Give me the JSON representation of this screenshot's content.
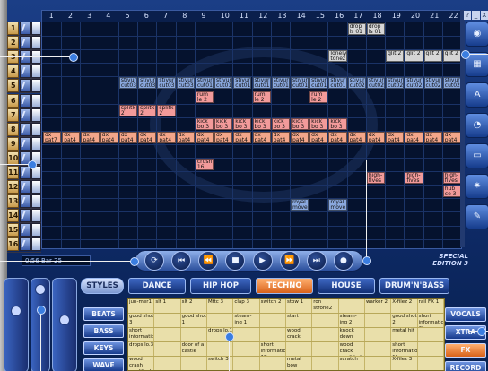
{
  "ruler": [
    "1",
    "2",
    "3",
    "4",
    "5",
    "6",
    "7",
    "8",
    "9",
    "10",
    "11",
    "12",
    "13",
    "14",
    "15",
    "16",
    "17",
    "18",
    "19",
    "20",
    "21",
    "22"
  ],
  "tracks": [
    "1",
    "2",
    "3",
    "4",
    "5",
    "6",
    "7",
    "8",
    "9",
    "10",
    "11",
    "12",
    "13",
    "14",
    "15",
    "16"
  ],
  "blocks": [
    {
      "row": 0,
      "col": 16,
      "span": 1,
      "text": "drop is 01",
      "color": "gray"
    },
    {
      "row": 0,
      "col": 17,
      "span": 1,
      "text": "drop is 01",
      "color": "gray"
    },
    {
      "row": 2,
      "col": 15,
      "span": 1,
      "text": "lonely tonez 3",
      "color": "gray"
    },
    {
      "row": 2,
      "col": 18,
      "span": 1,
      "text": "glit 2",
      "color": "gray"
    },
    {
      "row": 2,
      "col": 19,
      "span": 1,
      "text": "glit 2",
      "color": "gray"
    },
    {
      "row": 2,
      "col": 20,
      "span": 1,
      "text": "glit 2",
      "color": "gray"
    },
    {
      "row": 2,
      "col": 21,
      "span": 1,
      "text": "glit 2",
      "color": "gray"
    },
    {
      "row": 4,
      "col": 4,
      "span": 1,
      "text": "stivur cut03",
      "color": "blue"
    },
    {
      "row": 4,
      "col": 5,
      "span": 1,
      "text": "stivur cut03",
      "color": "blue"
    },
    {
      "row": 4,
      "col": 6,
      "span": 1,
      "text": "stivur cut03",
      "color": "blue"
    },
    {
      "row": 4,
      "col": 7,
      "span": 1,
      "text": "stivur cut03",
      "color": "blue"
    },
    {
      "row": 4,
      "col": 8,
      "span": 1,
      "text": "stivur cut01",
      "color": "blue"
    },
    {
      "row": 4,
      "col": 9,
      "span": 1,
      "text": "stivur cut01",
      "color": "blue"
    },
    {
      "row": 4,
      "col": 10,
      "span": 1,
      "text": "stivur cut01",
      "color": "blue"
    },
    {
      "row": 4,
      "col": 11,
      "span": 1,
      "text": "stivur cut01",
      "color": "blue"
    },
    {
      "row": 4,
      "col": 12,
      "span": 1,
      "text": "stivur cut01",
      "color": "blue"
    },
    {
      "row": 4,
      "col": 13,
      "span": 1,
      "text": "stivur cut01",
      "color": "blue"
    },
    {
      "row": 4,
      "col": 14,
      "span": 1,
      "text": "stivur cut01",
      "color": "blue"
    },
    {
      "row": 4,
      "col": 15,
      "span": 1,
      "text": "stivur cut01",
      "color": "blue"
    },
    {
      "row": 4,
      "col": 16,
      "span": 1,
      "text": "stivur cut02",
      "color": "blue"
    },
    {
      "row": 4,
      "col": 17,
      "span": 1,
      "text": "stivur cut02",
      "color": "blue"
    },
    {
      "row": 4,
      "col": 18,
      "span": 1,
      "text": "stivur cut02",
      "color": "blue"
    },
    {
      "row": 4,
      "col": 19,
      "span": 1,
      "text": "stivur cut02",
      "color": "blue"
    },
    {
      "row": 4,
      "col": 20,
      "span": 1,
      "text": "stivur cut02",
      "color": "blue"
    },
    {
      "row": 4,
      "col": 21,
      "span": 1,
      "text": "stivur cut02",
      "color": "blue"
    },
    {
      "row": 5,
      "col": 8,
      "span": 1,
      "text": "rum le 2",
      "color": "pink"
    },
    {
      "row": 5,
      "col": 11,
      "span": 1,
      "text": "rum le 2",
      "color": "pink"
    },
    {
      "row": 5,
      "col": 14,
      "span": 1,
      "text": "rum le 2",
      "color": "pink"
    },
    {
      "row": 6,
      "col": 4,
      "span": 1,
      "text": "splitk 2",
      "color": "pink"
    },
    {
      "row": 6,
      "col": 5,
      "span": 1,
      "text": "splitk 2",
      "color": "pink"
    },
    {
      "row": 6,
      "col": 6,
      "span": 1,
      "text": "splitk 2",
      "color": "pink"
    },
    {
      "row": 7,
      "col": 8,
      "span": 1,
      "text": "kick bo 3",
      "color": "pink"
    },
    {
      "row": 7,
      "col": 9,
      "span": 1,
      "text": "kick bo 3",
      "color": "pink"
    },
    {
      "row": 7,
      "col": 10,
      "span": 1,
      "text": "kick bo 3",
      "color": "pink"
    },
    {
      "row": 7,
      "col": 11,
      "span": 1,
      "text": "kick bo 3",
      "color": "pink"
    },
    {
      "row": 7,
      "col": 12,
      "span": 1,
      "text": "kick bo 3",
      "color": "pink"
    },
    {
      "row": 7,
      "col": 13,
      "span": 1,
      "text": "kick bo 3",
      "color": "pink"
    },
    {
      "row": 7,
      "col": 14,
      "span": 1,
      "text": "kick bo 3",
      "color": "pink"
    },
    {
      "row": 7,
      "col": 15,
      "span": 1,
      "text": "kick bo 3",
      "color": "pink"
    },
    {
      "row": 8,
      "col": 0,
      "span": 1,
      "text": "dx pat7",
      "color": "salmon"
    },
    {
      "row": 8,
      "col": 1,
      "span": 1,
      "text": "dx pat4",
      "color": "salmon"
    },
    {
      "row": 8,
      "col": 2,
      "span": 1,
      "text": "dx pat4",
      "color": "salmon"
    },
    {
      "row": 8,
      "col": 3,
      "span": 1,
      "text": "dx pat4",
      "color": "salmon"
    },
    {
      "row": 8,
      "col": 4,
      "span": 1,
      "text": "dx pat4",
      "color": "salmon"
    },
    {
      "row": 8,
      "col": 5,
      "span": 1,
      "text": "dx pat4",
      "color": "salmon"
    },
    {
      "row": 8,
      "col": 6,
      "span": 1,
      "text": "dx pat4",
      "color": "salmon"
    },
    {
      "row": 8,
      "col": 7,
      "span": 1,
      "text": "dx pat4",
      "color": "salmon"
    },
    {
      "row": 8,
      "col": 8,
      "span": 1,
      "text": "dx pat4",
      "color": "salmon"
    },
    {
      "row": 8,
      "col": 9,
      "span": 1,
      "text": "dx pat4",
      "color": "salmon"
    },
    {
      "row": 8,
      "col": 10,
      "span": 1,
      "text": "dx pat4",
      "color": "salmon"
    },
    {
      "row": 8,
      "col": 11,
      "span": 1,
      "text": "dx pat4",
      "color": "salmon"
    },
    {
      "row": 8,
      "col": 12,
      "span": 1,
      "text": "dx pat4",
      "color": "salmon"
    },
    {
      "row": 8,
      "col": 13,
      "span": 1,
      "text": "dx pat4",
      "color": "salmon"
    },
    {
      "row": 8,
      "col": 14,
      "span": 1,
      "text": "dx pat4",
      "color": "salmon"
    },
    {
      "row": 8,
      "col": 15,
      "span": 1,
      "text": "dx pat4",
      "color": "salmon"
    },
    {
      "row": 8,
      "col": 16,
      "span": 1,
      "text": "dx pat4",
      "color": "salmon"
    },
    {
      "row": 8,
      "col": 17,
      "span": 1,
      "text": "dx pat4",
      "color": "salmon"
    },
    {
      "row": 8,
      "col": 18,
      "span": 1,
      "text": "dx pat4",
      "color": "salmon"
    },
    {
      "row": 8,
      "col": 19,
      "span": 1,
      "text": "dx pat4",
      "color": "salmon"
    },
    {
      "row": 8,
      "col": 20,
      "span": 1,
      "text": "dx pat4",
      "color": "salmon"
    },
    {
      "row": 8,
      "col": 21,
      "span": 1,
      "text": "dx pat4",
      "color": "salmon"
    },
    {
      "row": 10,
      "col": 8,
      "span": 1,
      "text": "crush 16",
      "color": "pink"
    },
    {
      "row": 11,
      "col": 17,
      "span": 1,
      "text": "high-fives 2",
      "color": "pink"
    },
    {
      "row": 11,
      "col": 19,
      "span": 1,
      "text": "high-fives 3",
      "color": "pink"
    },
    {
      "row": 11,
      "col": 21,
      "span": 1,
      "text": "high-fives 3",
      "color": "pink"
    },
    {
      "row": 12,
      "col": 21,
      "span": 1,
      "text": "hub ce 3",
      "color": "pink"
    },
    {
      "row": 13,
      "col": 13,
      "span": 1,
      "text": "royal move 2R",
      "color": "blue"
    },
    {
      "row": 13,
      "col": 15,
      "span": 1,
      "text": "royal move 2R",
      "color": "blue"
    }
  ],
  "window_buttons": [
    "?",
    "_",
    "X"
  ],
  "right_tools": [
    {
      "name": "sphere-icon",
      "glyph": "◉"
    },
    {
      "name": "piano-icon",
      "glyph": "▦"
    },
    {
      "name": "audio-icon",
      "glyph": "A"
    },
    {
      "name": "timer-icon",
      "glyph": "◔"
    },
    {
      "name": "monitor-icon",
      "glyph": "▭"
    },
    {
      "name": "burst-icon",
      "glyph": "✷"
    },
    {
      "name": "pen-icon",
      "glyph": "✎"
    }
  ],
  "transport": {
    "time": "0:56 Bar 25",
    "buttons": [
      {
        "name": "loop-button",
        "glyph": "⟳"
      },
      {
        "name": "rewind-start-button",
        "glyph": "⏮"
      },
      {
        "name": "rewind-button",
        "glyph": "⏪"
      },
      {
        "name": "stop-button",
        "glyph": "■"
      },
      {
        "name": "play-button",
        "glyph": "▶"
      },
      {
        "name": "fast-forward-button",
        "glyph": "⏩"
      },
      {
        "name": "forward-end-button",
        "glyph": "⏭"
      },
      {
        "name": "record-button",
        "glyph": "●"
      }
    ],
    "edition_line1": "SPECIAL",
    "edition_line2": "EDITION 3"
  },
  "styles": {
    "label": "STYLES",
    "items": [
      {
        "label": "DANCE",
        "active": false
      },
      {
        "label": "HIP HOP",
        "active": false
      },
      {
        "label": "TECHNO",
        "active": true
      },
      {
        "label": "HOUSE",
        "active": false
      },
      {
        "label": "DRUM'N'BASS",
        "active": false
      }
    ]
  },
  "categories": [
    "BEATS",
    "BASS",
    "KEYS",
    "WAVE"
  ],
  "fx_buttons": [
    {
      "label": "VOCALS",
      "active": false
    },
    {
      "label": "XTRA",
      "active": false
    },
    {
      "label": "FX",
      "active": true
    },
    {
      "label": "RECORD",
      "active": false
    }
  ],
  "library": [
    [
      "jun-mer1",
      "slt 1",
      "slt 2",
      "Mftc 3",
      "clap 3",
      "switch 2",
      "stow 1",
      "ron strohe2",
      "",
      "warker 2",
      "X-filez 2",
      "rail FX 1"
    ],
    [
      "good shot 3",
      "",
      "good shot 1",
      "",
      "steam-ing 1",
      "",
      "start",
      "",
      "steam-ing 2",
      "",
      "good shot 2",
      "short information 2L"
    ],
    [
      "short information 2R",
      "",
      "",
      "drops lo.1",
      "",
      "",
      "wood crack",
      "",
      "knock down",
      "",
      "metal hit",
      ""
    ],
    [
      "drops lo.3",
      "",
      "door of a castle",
      "",
      "",
      "short information 1R",
      "",
      "",
      "wood crack modified 2",
      "",
      "short information 1L",
      ""
    ],
    [
      "wood crash modified 1",
      "",
      "",
      "switch 3",
      "",
      "",
      "metal bow",
      "",
      "scratch",
      "",
      "X-filez 3",
      ""
    ]
  ]
}
